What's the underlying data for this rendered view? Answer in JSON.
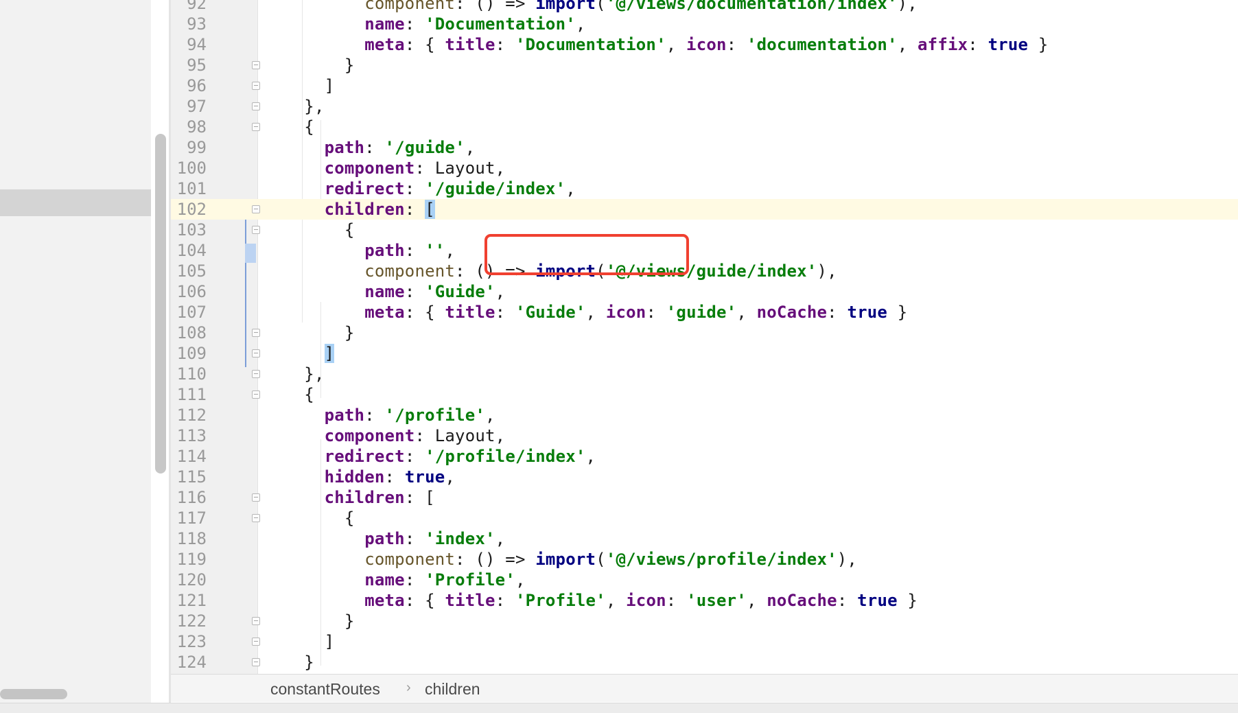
{
  "editor": {
    "language": "javascript",
    "current_line": 102,
    "lines": [
      {
        "num": "92",
        "html": "        <span class=\"dim\">component</span>: () =&gt; <span class=\"kw\">import</span>(<span class=\"s\">'@/views/documentation/index'</span>),"
      },
      {
        "num": "93",
        "html": "        <span class=\"k\">name</span>: <span class=\"s\">'Documentation'</span>,"
      },
      {
        "num": "94",
        "html": "        <span class=\"k\">meta</span>: { <span class=\"k\">title</span>: <span class=\"s\">'Documentation'</span>, <span class=\"k\">icon</span>: <span class=\"s\">'documentation'</span>, <span class=\"k\">affix</span>: <span class=\"kw\">true</span> }"
      },
      {
        "num": "95",
        "html": "      }"
      },
      {
        "num": "96",
        "html": "    ]"
      },
      {
        "num": "97",
        "html": "  },"
      },
      {
        "num": "98",
        "html": "  {"
      },
      {
        "num": "99",
        "html": "    <span class=\"k\">path</span>: <span class=\"s\">'/guide'</span>,"
      },
      {
        "num": "100",
        "html": "    <span class=\"k\">component</span>: Layout,"
      },
      {
        "num": "101",
        "html": "    <span class=\"k\">redirect</span>: <span class=\"s\">'/guide/index'</span>,"
      },
      {
        "num": "102",
        "html": "    <span class=\"k\">children</span>: <span class=\"bracket-hl\">[</span>"
      },
      {
        "num": "103",
        "html": "      {"
      },
      {
        "num": "104",
        "html": "        <span class=\"k\">path</span>: <span class=\"s\">''</span>,"
      },
      {
        "num": "105",
        "html": "        <span class=\"dim\">component</span>: () =&gt; <span class=\"kw\">import</span>(<span class=\"s\">'@/views/guide/index'</span>),"
      },
      {
        "num": "106",
        "html": "        <span class=\"k\">name</span>: <span class=\"s\">'Guide'</span>,"
      },
      {
        "num": "107",
        "html": "        <span class=\"k\">meta</span>: { <span class=\"k\">title</span>: <span class=\"s\">'Guide'</span>, <span class=\"k\">icon</span>: <span class=\"s\">'guide'</span>, <span class=\"k\">noCache</span>: <span class=\"kw\">true</span> }"
      },
      {
        "num": "108",
        "html": "      }"
      },
      {
        "num": "109",
        "html": "    <span class=\"bracket-hl\">]</span>"
      },
      {
        "num": "110",
        "html": "  },"
      },
      {
        "num": "111",
        "html": "  {"
      },
      {
        "num": "112",
        "html": "    <span class=\"k\">path</span>: <span class=\"s\">'/profile'</span>,"
      },
      {
        "num": "113",
        "html": "    <span class=\"k\">component</span>: Layout,"
      },
      {
        "num": "114",
        "html": "    <span class=\"k\">redirect</span>: <span class=\"s\">'/profile/index'</span>,"
      },
      {
        "num": "115",
        "html": "    <span class=\"k\">hidden</span>: <span class=\"kw\">true</span>,"
      },
      {
        "num": "116",
        "html": "    <span class=\"k\">children</span>: ["
      },
      {
        "num": "117",
        "html": "      {"
      },
      {
        "num": "118",
        "html": "        <span class=\"k\">path</span>: <span class=\"s\">'index'</span>,"
      },
      {
        "num": "119",
        "html": "        <span class=\"dim\">component</span>: () =&gt; <span class=\"kw\">import</span>(<span class=\"s\">'@/views/profile/index'</span>),"
      },
      {
        "num": "120",
        "html": "        <span class=\"k\">name</span>: <span class=\"s\">'Profile'</span>,"
      },
      {
        "num": "121",
        "html": "        <span class=\"k\">meta</span>: { <span class=\"k\">title</span>: <span class=\"s\">'Profile'</span>, <span class=\"k\">icon</span>: <span class=\"s\">'user'</span>, <span class=\"k\">noCache</span>: <span class=\"kw\">true</span> }"
      },
      {
        "num": "122",
        "html": "      }"
      },
      {
        "num": "123",
        "html": "    ]"
      },
      {
        "num": "124",
        "html": "  }"
      }
    ],
    "fold_lines": [
      "95",
      "96",
      "97",
      "98",
      "102",
      "103",
      "108",
      "109",
      "110",
      "111",
      "116",
      "117",
      "122",
      "123",
      "124"
    ]
  },
  "breadcrumb": {
    "items": [
      "constantRoutes",
      "children"
    ],
    "separator": "›"
  },
  "annotation": {
    "color": "#f04030",
    "target_line": "104"
  }
}
